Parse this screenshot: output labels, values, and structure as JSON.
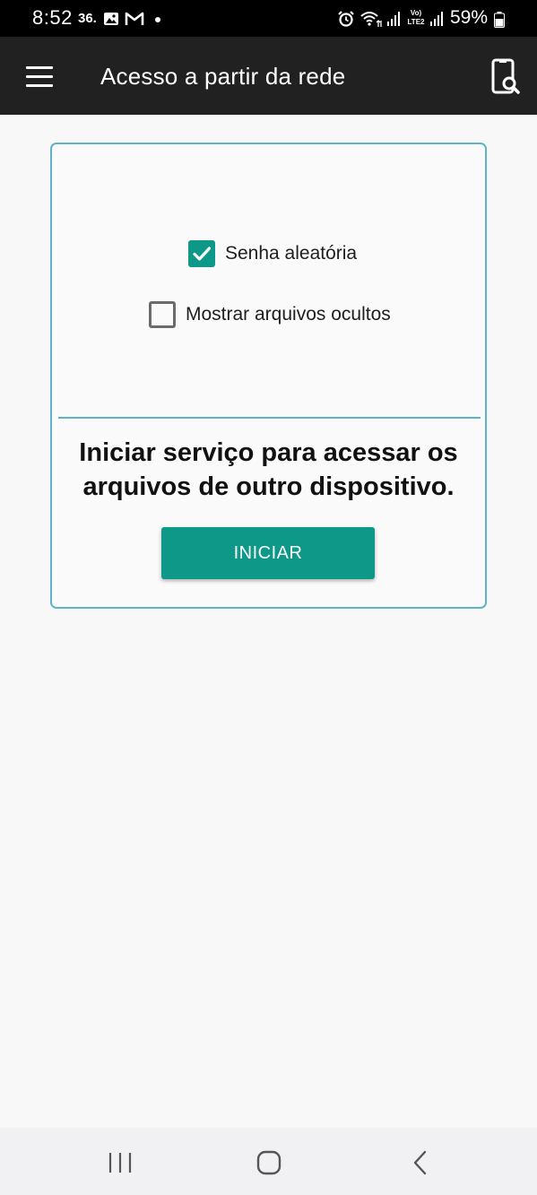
{
  "status_bar": {
    "time": "8:52",
    "notification_text": "36.",
    "battery_percent": "59%",
    "icons": [
      "gallery-icon",
      "gmail-icon",
      "notification-dot-icon",
      "alarm-icon",
      "wifi-icon",
      "signal-icon",
      "volte-icon",
      "signal-icon",
      "battery-icon"
    ],
    "volte_line1": "Vo)",
    "volte_line2": "LTE2"
  },
  "app_bar": {
    "title": "Acesso a partir da rede",
    "menu_icon": "hamburger-menu-icon",
    "action_icon": "device-search-icon"
  },
  "card": {
    "options": [
      {
        "label": "Senha aleatória",
        "checked": true
      },
      {
        "label": "Mostrar arquivos ocultos",
        "checked": false
      }
    ],
    "message": "Iniciar serviço para acessar os arquivos de outro dispositivo.",
    "start_button_label": "INICIAR"
  },
  "nav_bar": {
    "icons": [
      "recents-icon",
      "home-icon",
      "back-icon"
    ]
  },
  "colors": {
    "accent": "#0d9888",
    "card_border": "#5fb3c9",
    "app_bar": "#212121",
    "status_bar": "#000000",
    "background": "#f8f8f9"
  }
}
